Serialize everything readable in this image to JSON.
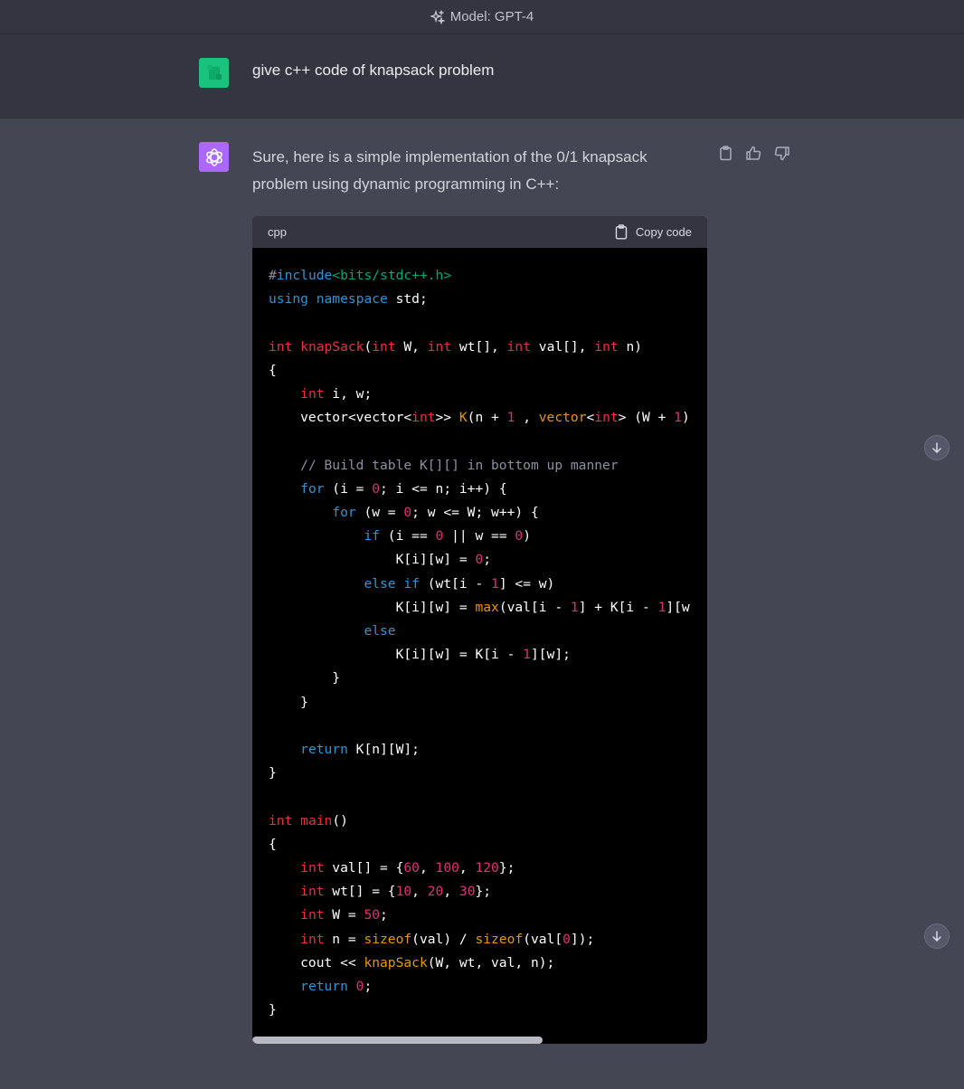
{
  "header": {
    "model_label": "Model: GPT-4"
  },
  "user_message": {
    "text": "give c++ code of knapsack problem"
  },
  "assistant_message": {
    "intro": "Sure, here is a simple implementation of the 0/1 knapsack problem using dynamic programming in C++:",
    "code_block": {
      "language": "cpp",
      "copy_label": "Copy code",
      "lines": [
        "#include<bits/stdc++.h>",
        "using namespace std;",
        "",
        "int knapSack(int W, int wt[], int val[], int n)",
        "{",
        "    int i, w;",
        "    vector<vector<int>> K(n + 1 , vector<int> (W + 1)",
        "",
        "    // Build table K[][] in bottom up manner",
        "    for (i = 0; i <= n; i++) {",
        "        for (w = 0; w <= W; w++) {",
        "            if (i == 0 || w == 0)",
        "                K[i][w] = 0;",
        "            else if (wt[i - 1] <= w)",
        "                K[i][w] = max(val[i - 1] + K[i - 1][w",
        "            else",
        "                K[i][w] = K[i - 1][w];",
        "        }",
        "    }",
        "",
        "    return K[n][W];",
        "}",
        "",
        "int main()",
        "{",
        "    int val[] = {60, 100, 120};",
        "    int wt[] = {10, 20, 30};",
        "    int W = 50;",
        "    int n = sizeof(val) / sizeof(val[0]);",
        "    cout << knapSack(W, wt, val, n);",
        "    return 0;",
        "}"
      ]
    }
  },
  "icons": {
    "model": "sparkle-icon",
    "user_avatar": "user-avatar",
    "bot_avatar": "openai-logo-icon",
    "copy": "clipboard-icon",
    "thumbs_up": "thumbs-up-icon",
    "thumbs_down": "thumbs-down-icon",
    "scroll_down": "arrow-down-icon"
  },
  "colors": {
    "user_avatar_bg": "#19c37d",
    "bot_avatar_bg": "#ab68ff",
    "keyword": "#2e95d3",
    "type": "#f22c3d",
    "number": "#df3079",
    "function": "#e9950c",
    "string": "#00a67d"
  }
}
